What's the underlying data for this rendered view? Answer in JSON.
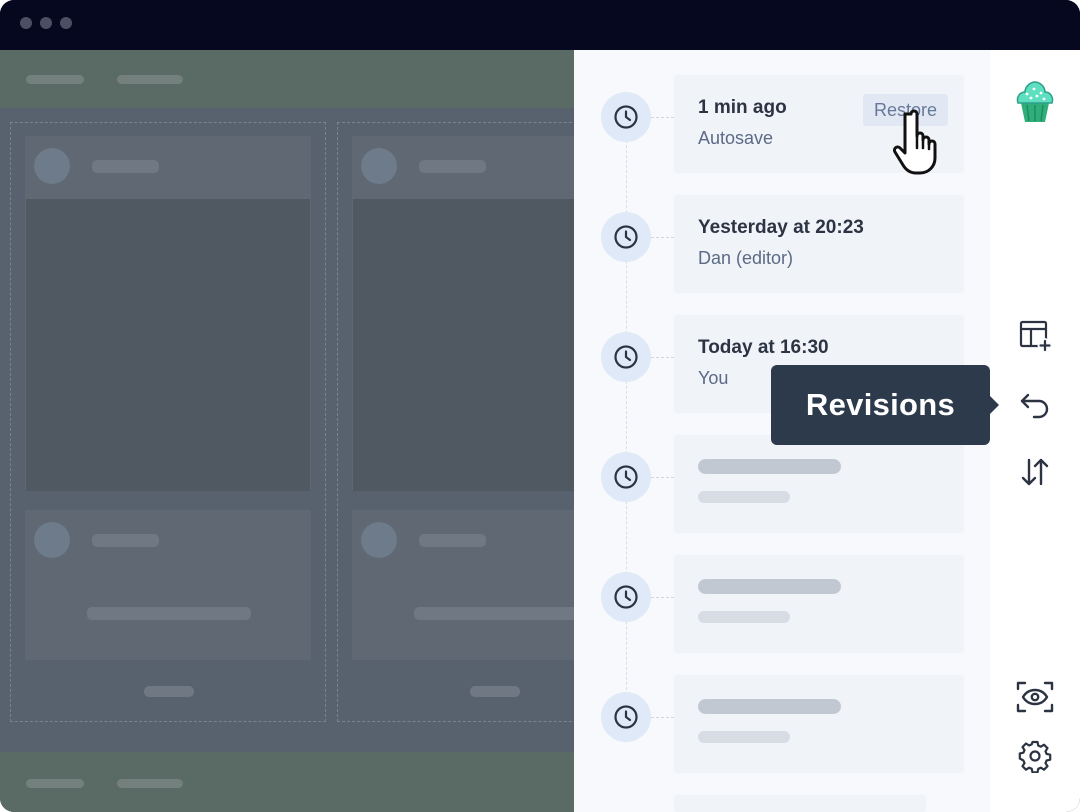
{
  "window": {
    "controls": [
      "window-dot",
      "window-dot",
      "window-dot"
    ]
  },
  "revisions": [
    {
      "title": "1 min ago",
      "subtitle": "Autosave",
      "action_label": "Restore"
    },
    {
      "title": "Yesterday at 20:23",
      "subtitle": "Dan (editor)"
    },
    {
      "title": "Today at 16:30",
      "subtitle": "You"
    },
    {
      "placeholder": true
    },
    {
      "placeholder": true
    },
    {
      "placeholder": true
    }
  ],
  "tooltip": {
    "label": "Revisions"
  },
  "rail": {
    "icons": [
      "cupcake-avatar-icon",
      "add-layout-icon",
      "undo-revisions-icon",
      "sort-arrows-icon",
      "preview-eye-icon",
      "settings-gear-icon"
    ]
  },
  "colors": {
    "titlebar": "#05081f",
    "overlay": "#58626e",
    "panel": "#f8f9fc",
    "tooltip": "#2c3a4b",
    "accent_clock_bg": "#dfe9f7"
  }
}
